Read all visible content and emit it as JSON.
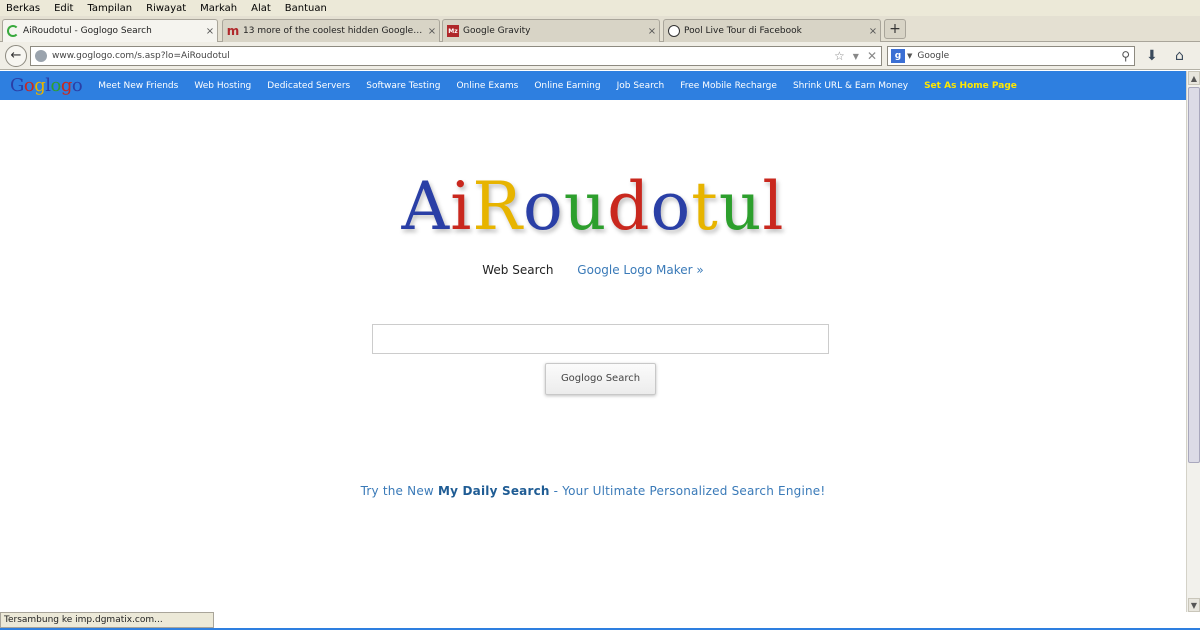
{
  "menu": [
    "Berkas",
    "Edit",
    "Tampilan",
    "Riwayat",
    "Markah",
    "Alat",
    "Bantuan"
  ],
  "tabs": [
    {
      "label": "AiRoudotul - Goglogo Search",
      "icon": "loading-spinner-icon",
      "active": true
    },
    {
      "label": "13 more of the coolest hidden Google tric...",
      "icon": "m-site-icon",
      "active": false
    },
    {
      "label": "Google Gravity",
      "icon": "mz-site-icon",
      "active": false
    },
    {
      "label": "Pool Live Tour di Facebook",
      "icon": "facebook-site-icon",
      "active": false
    }
  ],
  "tab_close_glyph": "×",
  "new_tab_glyph": "+",
  "address": {
    "url": "www.goglogo.com/s.asp?lo=AiRoudotul"
  },
  "search": {
    "placeholder": "Google"
  },
  "site_nav": {
    "logo": "Goglogo",
    "items": [
      "Meet New Friends",
      "Web Hosting",
      "Dedicated Servers",
      "Software Testing",
      "Online Exams",
      "Online Earning",
      "Job Search",
      "Free Mobile Recharge",
      "Shrink URL & Earn Money"
    ],
    "home_link": "Set As Home Page"
  },
  "logo": {
    "text": "AiRoudotul",
    "colors": [
      "#2a3fa6",
      "#c9281e",
      "#e7b400",
      "#2a3fa6",
      "#2d9f2d",
      "#c9281e",
      "#2a3fa6",
      "#e7b400",
      "#2d9f2d",
      "#c9281e"
    ]
  },
  "nav_colors": {
    "accent": "#2e7fe0",
    "home_link": "#ffe800"
  },
  "links": {
    "web_search": "Web Search",
    "logo_maker": "Google Logo Maker »"
  },
  "query": {
    "value": ""
  },
  "search_button": "Goglogo Search",
  "promo": {
    "prefix": "Try the New",
    "highlight": "My Daily Search",
    "suffix": "- Your Ultimate Personalized Search Engine!"
  },
  "status": "Tersambung ke imp.dgmatix.com..."
}
